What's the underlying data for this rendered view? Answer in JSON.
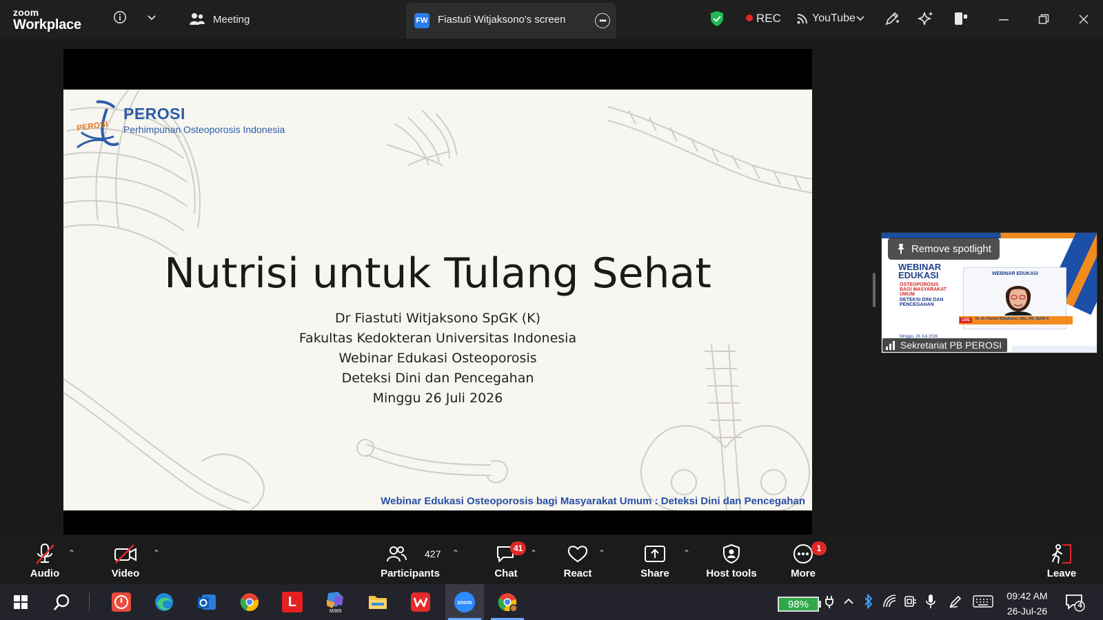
{
  "app": {
    "brand_top": "zoom",
    "brand_bottom": "Workplace",
    "meeting_label": "Meeting",
    "share_tab_initials": "FW",
    "share_tab_label": "Fiastuti Witjaksono's screen",
    "rec_label": "REC",
    "stream_label": "YouTube"
  },
  "slide": {
    "logo_mark": "PEROSI",
    "logo_title": "PEROSI",
    "logo_subtitle": "Perhimpunan Osteoporosis Indonesia",
    "title": "Nutrisi untuk Tulang Sehat",
    "lines": [
      "Dr Fiastuti Witjaksono SpGK (K)",
      "Fakultas Kedokteran Universitas Indonesia",
      "Webinar Edukasi Osteoporosis",
      "Deteksi Dini dan Pencegahan",
      "Minggu 26 Juli 2026"
    ],
    "footer": "Webinar Edukasi Osteoporosis bagi Masyarakat Umum : Deteksi Dini dan Pencegahan"
  },
  "spotlight": {
    "remove_label": "Remove spotlight",
    "participant_name": "Sekretariat PB PEROSI",
    "thumb_title": "WEBINAR EDUKASI",
    "thumb_sub": "OSTEOPOROSIS BAGI MASYARAKAT UMUM",
    "thumb_sub2": "DETEKSI DINI DAN PENCEGAHAN",
    "thumb_inner_title": "WEBINAR EDUKASI",
    "thumb_live": "LIVE",
    "thumb_speaker": "Dr. dr. Fiastuti Witjaksono, MSc, MS, SpGK-K",
    "thumb_date": "Minggu, 26 Juli 2026"
  },
  "controls": {
    "audio": "Audio",
    "video": "Video",
    "participants": "Participants",
    "participants_count": "427",
    "chat": "Chat",
    "chat_badge": "41",
    "react": "React",
    "share": "Share",
    "host_tools": "Host tools",
    "more": "More",
    "more_badge": "1",
    "leave": "Leave"
  },
  "taskbar": {
    "battery": "98%",
    "time": "09:42 AM",
    "date": "26-Jul-26",
    "notification_count": "4",
    "apps": [
      "windows-start",
      "search",
      "app-red-clock",
      "edge",
      "outlook",
      "chrome",
      "app-l",
      "m365",
      "file-explorer",
      "wps",
      "zoom",
      "chrome-profile"
    ],
    "m365_label": "M365",
    "l_app_label": "L",
    "zoom_label": "zoom"
  },
  "colors": {
    "accent_blue": "#2c5ca8",
    "rec_red": "#e02828",
    "shield_green": "#1fb854",
    "battery_green": "#2fa84a"
  }
}
